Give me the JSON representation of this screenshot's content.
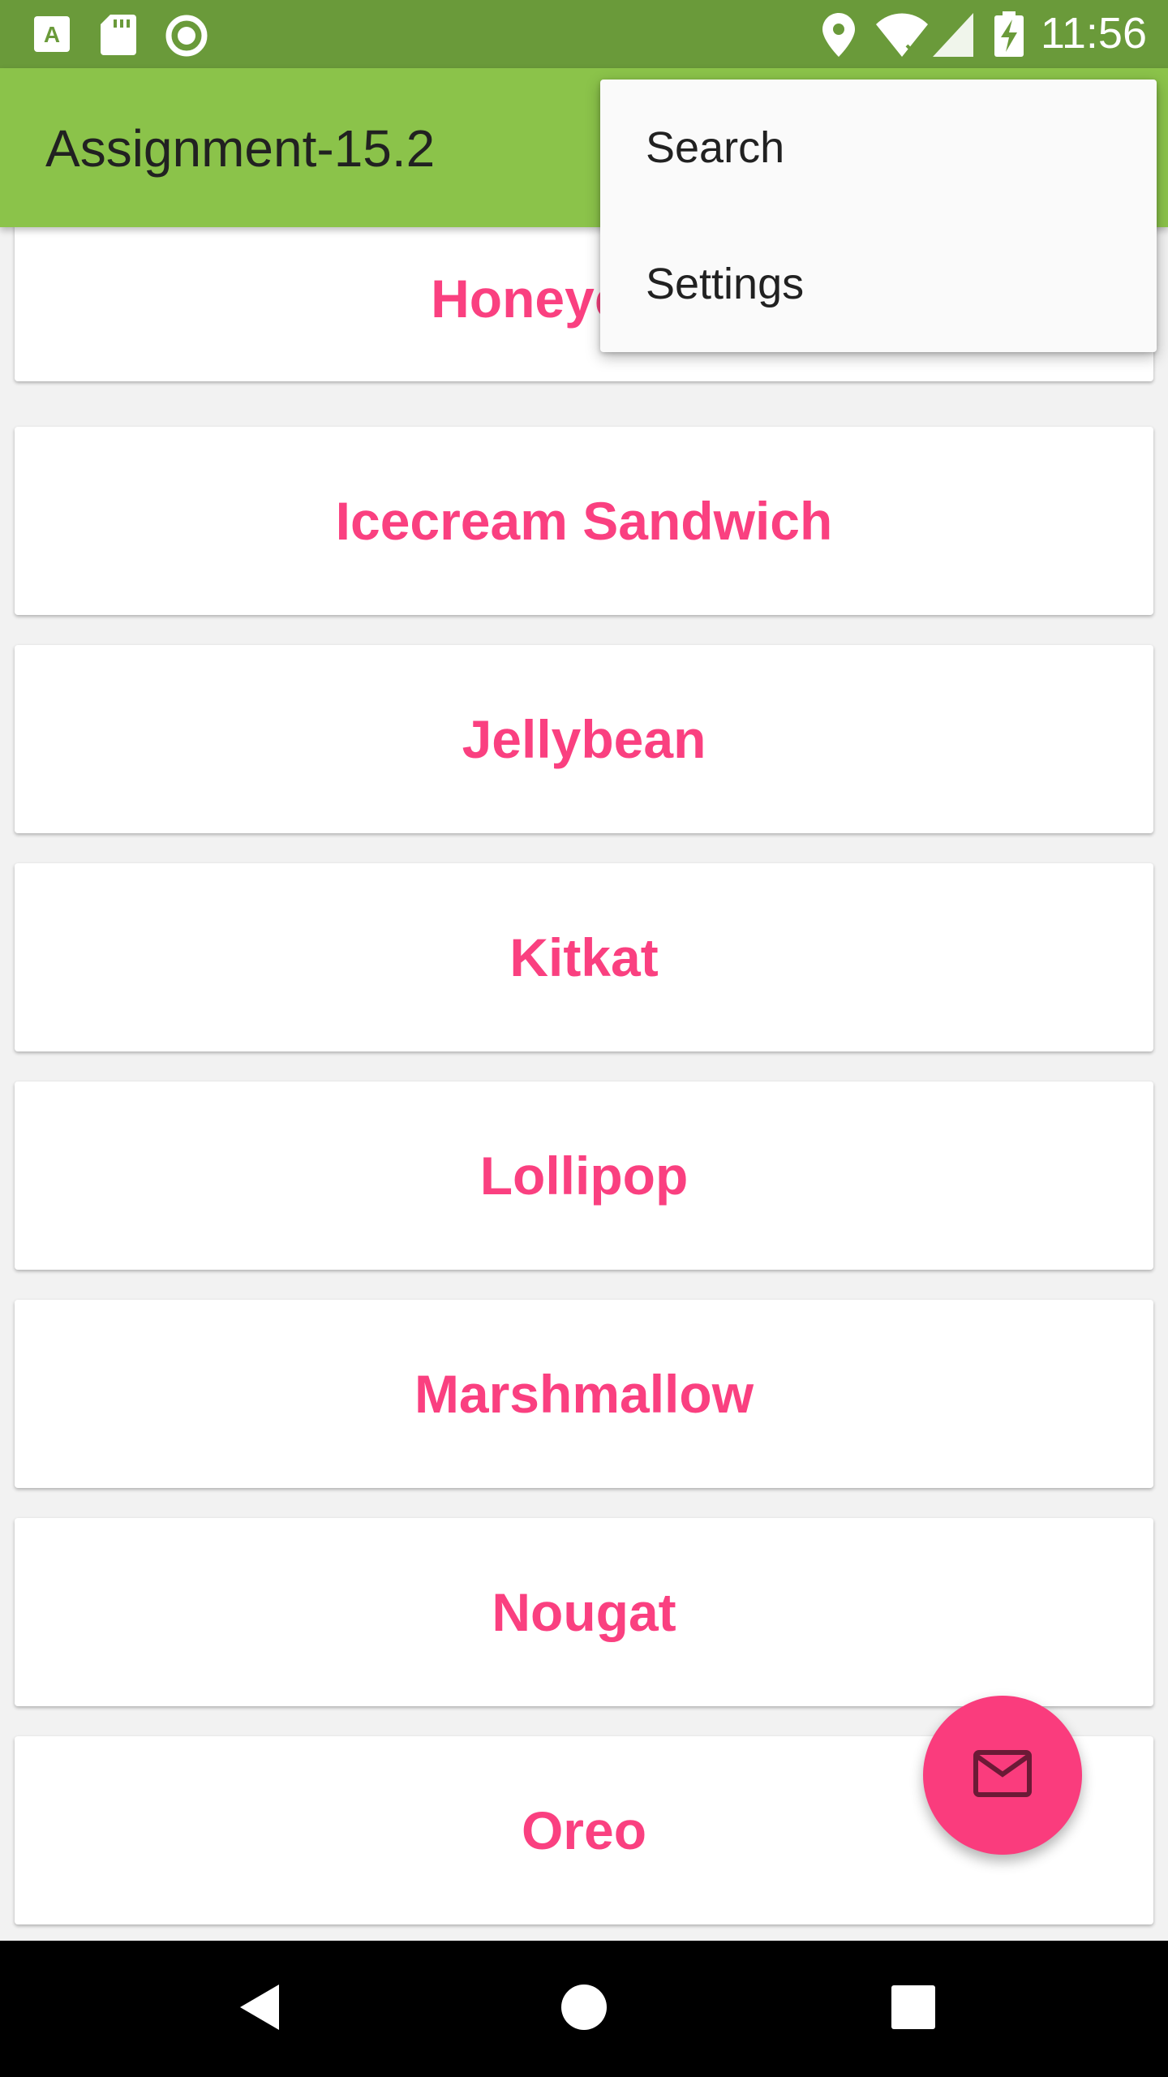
{
  "status_bar": {
    "time": "11:56",
    "icons_left": [
      "a-notification-icon",
      "sd-card-icon",
      "sync-icon"
    ],
    "icons_right": [
      "location-icon",
      "wifi-icon",
      "signal-icon",
      "battery-charging-icon"
    ]
  },
  "app_bar": {
    "title": "Assignment-15.2",
    "color": "#8bc34a"
  },
  "overflow_menu": {
    "items": [
      {
        "label": "Search"
      },
      {
        "label": "Settings"
      }
    ]
  },
  "list": {
    "items": [
      {
        "label": "Honeycomb"
      },
      {
        "label": "Icecream Sandwich"
      },
      {
        "label": "Jellybean"
      },
      {
        "label": "Kitkat"
      },
      {
        "label": "Lollipop"
      },
      {
        "label": "Marshmallow"
      },
      {
        "label": "Nougat"
      },
      {
        "label": "Oreo"
      }
    ],
    "text_color": "#fa4080"
  },
  "fab": {
    "icon": "mail-icon",
    "color": "#fa3c7d"
  },
  "nav_bar": {
    "buttons": [
      "back-icon",
      "home-icon",
      "recents-icon"
    ]
  }
}
